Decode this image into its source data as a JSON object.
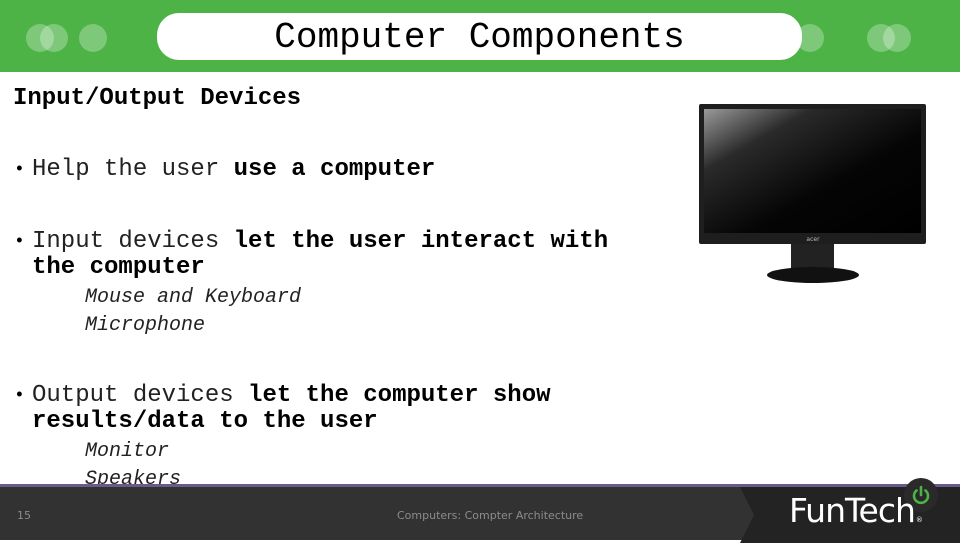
{
  "slide": {
    "title": "Computer Components",
    "heading": "Input/Output Devices",
    "bullets": [
      {
        "light": "Help the user ",
        "bold": "use a computer",
        "subitems": []
      },
      {
        "light": "Input devices ",
        "bold": "let the user interact with",
        "bold_line2": "the computer",
        "subitems": [
          "Mouse and Keyboard",
          "Microphone"
        ]
      },
      {
        "light": "Output devices ",
        "bold": "let the computer show",
        "bold_line2": "results/data to the user",
        "subitems": [
          "Monitor",
          "Speakers"
        ]
      }
    ],
    "bullet_glyph": "•",
    "image": {
      "subject": "computer monitor",
      "brand": "acer"
    }
  },
  "footer": {
    "page_number": "15",
    "course_text": "Computers: Compter Architecture",
    "logo_text": "FunTech",
    "logo_reg": "®"
  },
  "colors": {
    "header_green": "#4db347",
    "footer_bg": "#333232",
    "footer_line": "#6a5a87",
    "power_green": "#4db347"
  }
}
